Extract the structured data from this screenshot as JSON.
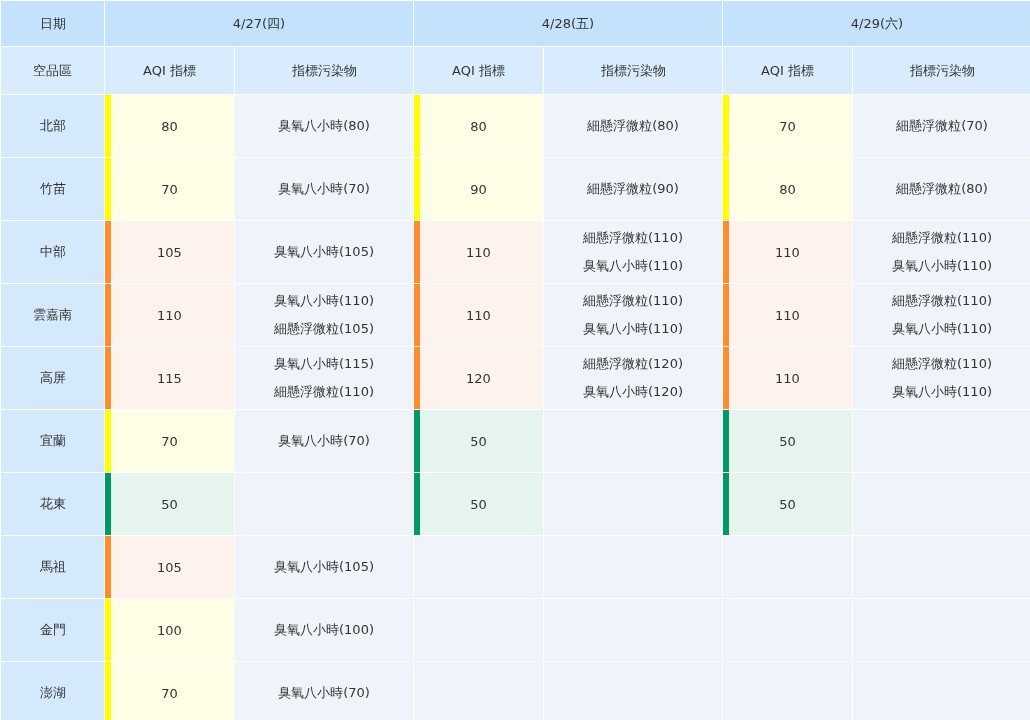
{
  "table": {
    "corner_top": "日期",
    "corner_bottom": "空品區",
    "days": [
      {
        "date": "4/27(四)",
        "aqi_header": "AQI 指標",
        "pollutant_header": "指標污染物"
      },
      {
        "date": "4/28(五)",
        "aqi_header": "AQI 指標",
        "pollutant_header": "指標污染物"
      },
      {
        "date": "4/29(六)",
        "aqi_header": "AQI 指標",
        "pollutant_header": "指標污染物"
      }
    ],
    "rows": [
      {
        "region": "北部",
        "forecasts": [
          {
            "aqi": "80",
            "color": "#ffff00",
            "pollutants": [
              "臭氧八小時(80)"
            ]
          },
          {
            "aqi": "80",
            "color": "#ffff00",
            "pollutants": [
              "細懸浮微粒(80)"
            ]
          },
          {
            "aqi": "70",
            "color": "#ffff00",
            "pollutants": [
              "細懸浮微粒(70)"
            ]
          }
        ]
      },
      {
        "region": "竹苗",
        "forecasts": [
          {
            "aqi": "70",
            "color": "#ffff00",
            "pollutants": [
              "臭氧八小時(70)"
            ]
          },
          {
            "aqi": "90",
            "color": "#ffff00",
            "pollutants": [
              "細懸浮微粒(90)"
            ]
          },
          {
            "aqi": "80",
            "color": "#ffff00",
            "pollutants": [
              "細懸浮微粒(80)"
            ]
          }
        ]
      },
      {
        "region": "中部",
        "forecasts": [
          {
            "aqi": "105",
            "color": "#ff8c2e",
            "pollutants": [
              "臭氧八小時(105)"
            ]
          },
          {
            "aqi": "110",
            "color": "#ff8c2e",
            "pollutants": [
              "細懸浮微粒(110)",
              "臭氧八小時(110)"
            ]
          },
          {
            "aqi": "110",
            "color": "#ff8c2e",
            "pollutants": [
              "細懸浮微粒(110)",
              "臭氧八小時(110)"
            ]
          }
        ]
      },
      {
        "region": "雲嘉南",
        "forecasts": [
          {
            "aqi": "110",
            "color": "#ff8c2e",
            "pollutants": [
              "臭氧八小時(110)",
              "細懸浮微粒(105)"
            ]
          },
          {
            "aqi": "110",
            "color": "#ff8c2e",
            "pollutants": [
              "細懸浮微粒(110)",
              "臭氧八小時(110)"
            ]
          },
          {
            "aqi": "110",
            "color": "#ff8c2e",
            "pollutants": [
              "細懸浮微粒(110)",
              "臭氧八小時(110)"
            ]
          }
        ]
      },
      {
        "region": "高屏",
        "forecasts": [
          {
            "aqi": "115",
            "color": "#ff8c2e",
            "pollutants": [
              "臭氧八小時(115)",
              "細懸浮微粒(110)"
            ]
          },
          {
            "aqi": "120",
            "color": "#ff8c2e",
            "pollutants": [
              "細懸浮微粒(120)",
              "臭氧八小時(120)"
            ]
          },
          {
            "aqi": "110",
            "color": "#ff8c2e",
            "pollutants": [
              "細懸浮微粒(110)",
              "臭氧八小時(110)"
            ]
          }
        ]
      },
      {
        "region": "宜蘭",
        "forecasts": [
          {
            "aqi": "70",
            "color": "#ffff00",
            "pollutants": [
              "臭氧八小時(70)"
            ]
          },
          {
            "aqi": "50",
            "color": "#009865"
          },
          {
            "aqi": "50",
            "color": "#009865"
          }
        ]
      },
      {
        "region": "花東",
        "forecasts": [
          {
            "aqi": "50",
            "color": "#009865"
          },
          {
            "aqi": "50",
            "color": "#009865"
          },
          {
            "aqi": "50",
            "color": "#009865"
          }
        ]
      },
      {
        "region": "馬祖",
        "forecasts": [
          {
            "aqi": "105",
            "color": "#ff8c2e",
            "pollutants": [
              "臭氧八小時(105)"
            ]
          }
        ]
      },
      {
        "region": "金門",
        "forecasts": [
          {
            "aqi": "100",
            "color": "#ffff00",
            "pollutants": [
              "臭氧八小時(100)"
            ]
          }
        ]
      },
      {
        "region": "澎湖",
        "forecasts": [
          {
            "aqi": "70",
            "color": "#ffff00",
            "pollutants": [
              "臭氧八小時(70)"
            ]
          }
        ]
      }
    ]
  }
}
